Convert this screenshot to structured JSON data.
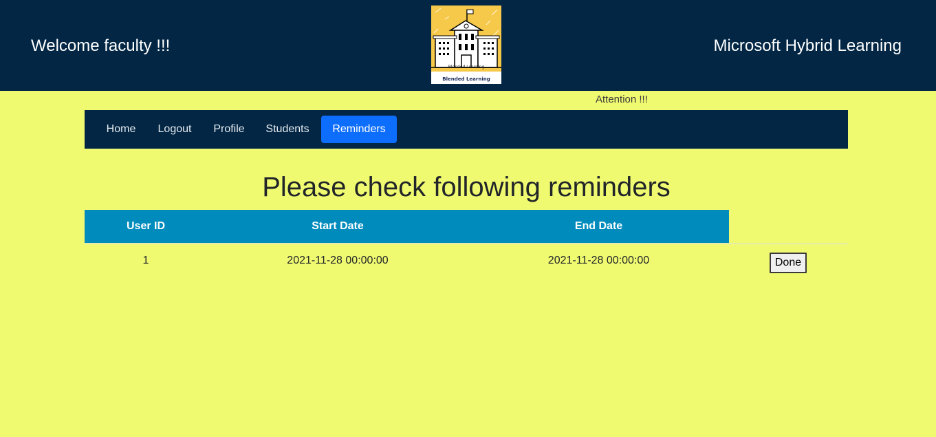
{
  "header": {
    "welcome": "Welcome faculty !!!",
    "brand": "Microsoft Hybrid Learning",
    "logo_caption": "Blended Learning",
    "logo_small_text": "Blended Learning",
    "background": "#022644"
  },
  "attention": "Attention !!!",
  "nav": {
    "items": [
      {
        "label": "Home",
        "active": false
      },
      {
        "label": "Logout",
        "active": false
      },
      {
        "label": "Profile",
        "active": false
      },
      {
        "label": "Students",
        "active": false
      },
      {
        "label": "Reminders",
        "active": true
      }
    ],
    "active_color": "#0d6efd"
  },
  "page_title": "Please check following reminders",
  "table": {
    "columns": [
      "User ID",
      "Start Date",
      "End Date"
    ],
    "header_color": "#008bbd",
    "rows": [
      {
        "user_id": "1",
        "start_date": "2021-11-28 00:00:00",
        "end_date": "2021-11-28 00:00:00",
        "action": "Done"
      }
    ]
  },
  "page_background": "#f0fa71"
}
